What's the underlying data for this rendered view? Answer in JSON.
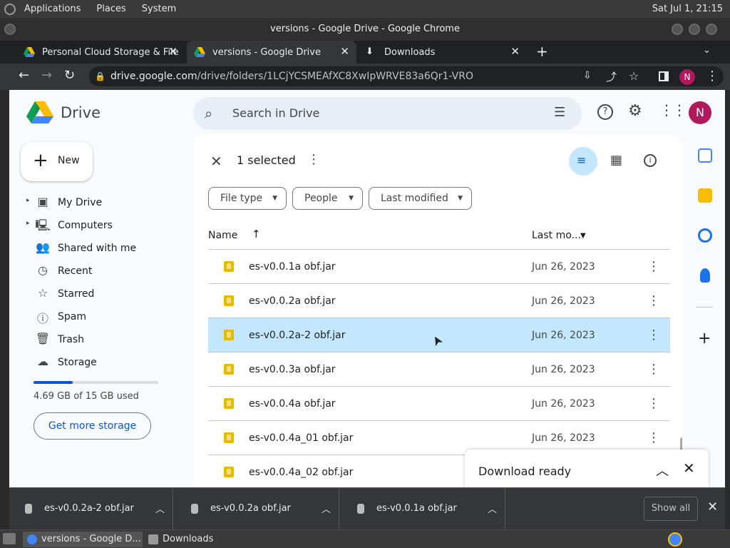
{
  "system": {
    "menus": [
      "Applications",
      "Places",
      "System"
    ],
    "clock": "Sat Jul  1, 21:15"
  },
  "window": {
    "title": "versions - Google Drive - Google Chrome"
  },
  "tabs": [
    {
      "label": "Personal Cloud Storage & File"
    },
    {
      "label": "versions - Google Drive"
    },
    {
      "label": "Downloads"
    }
  ],
  "address": {
    "host": "drive.google.com",
    "path": "/drive/folders/1LCjYCSMEAfXC8XwIpWRVE83a6Qr1-VRO"
  },
  "profile_initial": "N",
  "drive": {
    "logo_text": "Drive",
    "search_placeholder": "Search in Drive",
    "new_label": "New",
    "nav": [
      {
        "label": "My Drive",
        "icon": "my-drive-icon"
      },
      {
        "label": "Computers",
        "icon": "computer-icon"
      },
      {
        "label": "Shared with me",
        "icon": "people-icon"
      },
      {
        "label": "Recent",
        "icon": "clock-icon"
      },
      {
        "label": "Starred",
        "icon": "star-icon"
      },
      {
        "label": "Spam",
        "icon": "spam-icon"
      },
      {
        "label": "Trash",
        "icon": "trash-icon"
      },
      {
        "label": "Storage",
        "icon": "cloud-icon"
      }
    ],
    "storage": {
      "text": "4.69 GB of 15 GB used",
      "fraction": 0.313,
      "button": "Get more storage"
    },
    "selection": {
      "text": "1 selected"
    },
    "filters": [
      "File type",
      "People",
      "Last modified"
    ],
    "columns": {
      "name": "Name",
      "modified": "Last mo..."
    },
    "files": [
      {
        "name": "es-v0.0.1a obf.jar",
        "date": "Jun 26, 2023",
        "selected": false
      },
      {
        "name": "es-v0.0.2a obf.jar",
        "date": "Jun 26, 2023",
        "selected": false
      },
      {
        "name": "es-v0.0.2a-2 obf.jar",
        "date": "Jun 26, 2023",
        "selected": true
      },
      {
        "name": "es-v0.0.3a obf.jar",
        "date": "Jun 26, 2023",
        "selected": false
      },
      {
        "name": "es-v0.0.4a obf.jar",
        "date": "Jun 26, 2023",
        "selected": false
      },
      {
        "name": "es-v0.0.4a_01 obf.jar",
        "date": "Jun 26, 2023",
        "selected": false
      },
      {
        "name": "es-v0.0.4a_02 obf.jar",
        "date": "",
        "selected": false
      }
    ],
    "toast": {
      "title": "Download ready"
    }
  },
  "shelf": {
    "downloads": [
      "es-v0.0.2a-2 obf.jar",
      "es-v0.0.2a obf.jar",
      "es-v0.0.1a obf.jar"
    ],
    "show_all": "Show all"
  },
  "taskbar": [
    {
      "label": "versions - Google D..."
    },
    {
      "label": "Downloads"
    }
  ],
  "colors": {
    "accent": "#0b57d0",
    "selected_row": "#c2e7ff",
    "avatar": "#b0195c"
  }
}
